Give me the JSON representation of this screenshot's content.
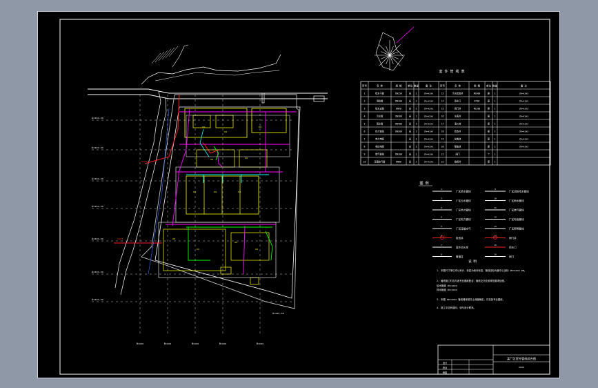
{
  "window": {
    "background": "#8e98a6",
    "canvas_bg": "#000000"
  },
  "colors": {
    "frame": "#ffffff",
    "road": "#ffffff",
    "building": "#ffff00",
    "magenta": "#ff00ff",
    "cyan": "#00ffff",
    "green": "#00ff00",
    "red": "#ff2020",
    "blue": "#3070ff",
    "boundary": "#cfcfcf"
  },
  "drawing": {
    "table_title": "室 外 管 线 表",
    "table_header": [
      "序号",
      "名 称",
      "规 格",
      "单位",
      "数量",
      "备 注",
      "序号",
      "名 称",
      "规 格",
      "单位",
      "数量",
      "备 注"
    ],
    "table_rows": [
      [
        "1",
        "给水干管",
        "DN150",
        "米",
        "1",
        "dn=xxxx",
        "13",
        "污水检查井",
        "Φ1000",
        "座",
        "1",
        "dn=xxxx"
      ],
      [
        "2",
        "消防管",
        "DN100",
        "米",
        "1",
        "dn=xxxx",
        "14",
        "雨水口",
        "Φ700",
        "座",
        "1",
        "dn=xxxx"
      ],
      [
        "3",
        "给水支管",
        "DN50",
        "米",
        "1",
        "dn=xxxx",
        "15",
        "阀门井",
        "Φ1200",
        "座",
        "1",
        "dn=xxxx"
      ],
      [
        "4",
        "污水管",
        "DN300",
        "米",
        "1",
        "dn=xxxx",
        "16",
        "水表井",
        "",
        "座",
        "1",
        "dn=xxxx"
      ],
      [
        "5",
        "雨水管",
        "DN400",
        "米",
        "1",
        "dn=xxxx",
        "17",
        "消火栓",
        "",
        "座",
        "1",
        "dn=xxxx"
      ],
      [
        "6",
        "热力管线",
        "DN200",
        "米",
        "1",
        "dn=xxxx",
        "18",
        "检查井",
        "",
        "座",
        "1",
        "dn=xxxx"
      ],
      [
        "7",
        "电力电缆",
        "",
        "米",
        "1",
        "dn=xxxx",
        "19",
        "化粪池",
        "",
        "座",
        "1",
        "dn=xxxx"
      ],
      [
        "8",
        "电信电缆",
        "",
        "米",
        "1",
        "dn=xxxx",
        "20",
        "隔油池",
        "",
        "座",
        "1",
        "dn=xxxx"
      ],
      [
        "9",
        "燃气管线",
        "DN100",
        "米",
        "1",
        "dn=xxxx",
        "21",
        "阀门",
        "",
        "个",
        "1",
        ""
      ],
      [
        "10",
        "压缩空气管",
        "DN80",
        "米",
        "1",
        "dn=xxxx",
        "22",
        "检修井",
        "",
        "座",
        "1",
        ""
      ]
    ],
    "legend_title": "图 例",
    "legend_items": [
      {
        "label": "厂区给水管线",
        "color": "#ffffff",
        "label2": "厂区消防给水管线",
        "color2": "#ffffff"
      },
      {
        "label": "厂区污水管线",
        "color": "#ffffff",
        "label2": "厂区雨水管线",
        "color2": "#ffffff"
      },
      {
        "label": "厂区热力管线",
        "color": "#ffffff",
        "label2": "厂区燃气管线",
        "color2": "#ffffff"
      },
      {
        "label": "厂区电力管线",
        "color": "#ffffff",
        "label2": "厂区电信管线",
        "color2": "#ffffff"
      },
      {
        "label": "厂区压缩空气",
        "color": "#ffffff",
        "label2": "厂区照明管线",
        "color2": "#ffffff"
      },
      {
        "label": "检查井",
        "color": "#ff2020",
        "label2": "阀门井",
        "color2": "#ff2020"
      },
      {
        "label": "室外消火栓",
        "color": "#ffffff",
        "label2": "雨水口",
        "color2": "#ff2020"
      },
      {
        "label": "管道井",
        "color": "#ffffff",
        "label2": "阀门",
        "color2": "#ffffff"
      }
    ],
    "notes_title": "说 明",
    "notes": [
      "1. 本图尺寸单位均以米计，标高为绝对标高，管线坐标为管中心坐标 dn=xxxx mm。",
      "2. 管线施工时应与各专业图纸配合，管线交叉处按规范要求处理。",
      "   给水管道  dn=xxxx",
      "   排水管道  dn=xxxx",
      "3. 本图 dn=xxxx 管线埋深按冻土深度确定，详见各专业图纸。",
      "4. 施工中如有疑问，请与设计联系。"
    ],
    "title_block": {
      "project": "某厂区室外管线综合图",
      "rows": [
        "设计",
        "校对",
        "审核",
        "批准"
      ]
    },
    "grid_labels_left": [
      "A=xxx.xx",
      "A=xxx.xx",
      "A=xxx.xx",
      "A=xxx.xx",
      "A=xxx.xx",
      "A=xxx.xx",
      "A=xxx.xx"
    ],
    "grid_labels_bottom": [
      "B=xxx",
      "B=xxx",
      "B=xxx",
      "B=xxx",
      "B=xxx"
    ]
  }
}
